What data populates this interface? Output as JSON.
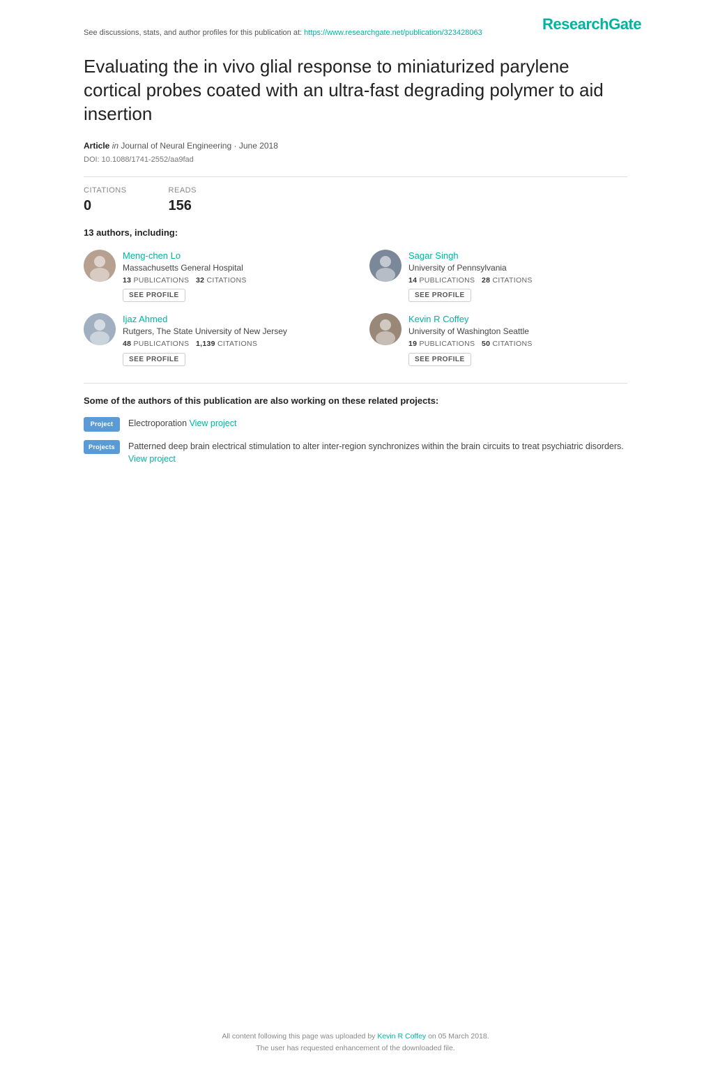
{
  "branding": {
    "logo": "ResearchGate",
    "logo_color": "#00b4a0"
  },
  "header": {
    "see_discussions_text": "See discussions, stats, and author profiles for this publication at:",
    "see_discussions_link": "https://www.researchgate.net/publication/323428063"
  },
  "title": "Evaluating the in vivo glial response to miniaturized parylene cortical probes coated with an ultra-fast degrading polymer to aid insertion",
  "article": {
    "type_label": "Article",
    "in_label": "in",
    "journal": "Journal of Neural Engineering",
    "date": "June 2018",
    "doi": "DOI: 10.1088/1741-2552/aa9fad"
  },
  "stats": {
    "citations_label": "CITATIONS",
    "citations_value": "0",
    "reads_label": "READS",
    "reads_value": "156"
  },
  "authors_heading": "13 authors, including:",
  "authors": [
    {
      "id": "1",
      "name": "Meng-chen Lo",
      "affiliation": "Massachusetts General Hospital",
      "publications": "13",
      "citations": "32",
      "avatar_color": "#b8a090"
    },
    {
      "id": "2",
      "name": "Sagar Singh",
      "affiliation": "University of Pennsylvania",
      "publications": "14",
      "citations": "28",
      "avatar_color": "#7a8899"
    },
    {
      "id": "3",
      "name": "Ijaz Ahmed",
      "affiliation": "Rutgers, The State University of New Jersey",
      "publications": "48",
      "citations": "1,139",
      "avatar_color": "#a0b0c0"
    },
    {
      "id": "4",
      "name": "Kevin R Coffey",
      "affiliation": "University of Washington Seattle",
      "publications": "19",
      "citations": "50",
      "avatar_color": "#998877"
    }
  ],
  "see_profile_label": "SEE PROFILE",
  "related_heading": "Some of the authors of this publication are also working on these related projects:",
  "projects": [
    {
      "badge": "Project",
      "text": "Electroporation",
      "link_text": "View project",
      "has_prefix": false
    },
    {
      "badge": "Projects",
      "text": "Patterned deep brain electrical stimulation to alter inter-region synchronizes within the brain circuits to treat psychiatric disorders.",
      "link_text": "View project",
      "has_prefix": false
    }
  ],
  "footer": {
    "line1_prefix": "All content following this page was uploaded by",
    "uploader": "Kevin R Coffey",
    "line1_suffix": "on 05 March 2018.",
    "line2": "The user has requested enhancement of the downloaded file."
  }
}
